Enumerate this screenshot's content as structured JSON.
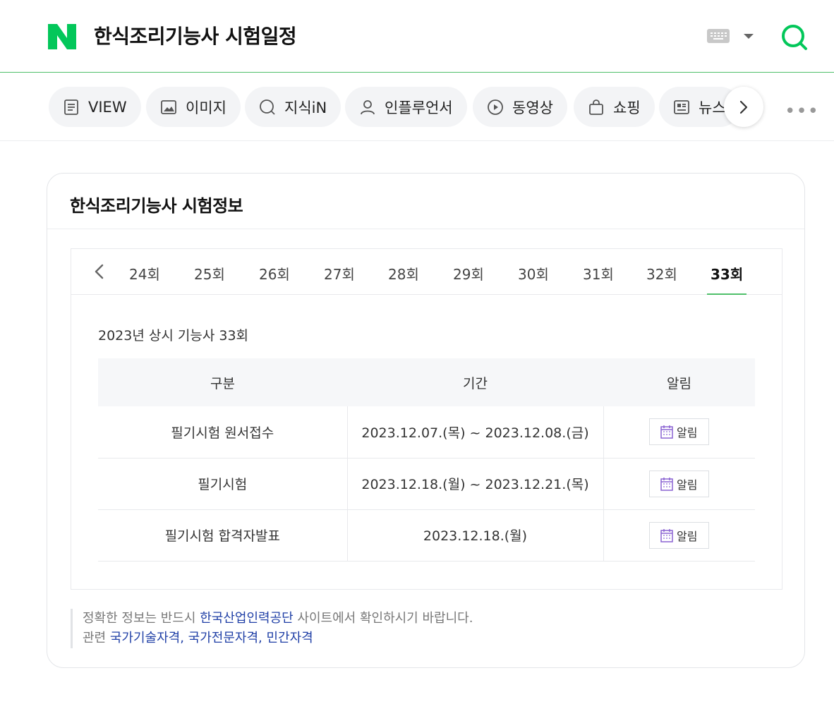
{
  "header": {
    "query": "한식조리기능사 시험일정",
    "brand_color": "#03c75a"
  },
  "tabs": [
    {
      "label": "VIEW",
      "icon": "view-icon"
    },
    {
      "label": "이미지",
      "icon": "image-icon"
    },
    {
      "label": "지식iN",
      "icon": "kin-icon"
    },
    {
      "label": "인플루언서",
      "icon": "person-icon"
    },
    {
      "label": "동영상",
      "icon": "play-icon"
    },
    {
      "label": "쇼핑",
      "icon": "bag-icon"
    },
    {
      "label": "뉴스",
      "icon": "news-icon"
    }
  ],
  "more_label": "•••",
  "card": {
    "title": "한식조리기능사 시험정보",
    "rounds": [
      "24회",
      "25회",
      "26회",
      "27회",
      "28회",
      "29회",
      "30회",
      "31회",
      "32회",
      "33회"
    ],
    "active_round": "33회",
    "exam_title": "2023년 상시 기능사 33회",
    "table": {
      "headers": [
        "구분",
        "기간",
        "알림"
      ],
      "rows": [
        {
          "category": "필기시험 원서접수",
          "period": "2023.12.07.(목) ~ 2023.12.08.(금)",
          "action": "알림"
        },
        {
          "category": "필기시험",
          "period": "2023.12.18.(월) ~ 2023.12.21.(목)",
          "action": "알림"
        },
        {
          "category": "필기시험 합격자발표",
          "period": "2023.12.18.(월)",
          "action": "알림"
        }
      ]
    },
    "notice": {
      "prefix": "정확한 정보는 반드시 ",
      "link": "한국산업인력공단",
      "suffix": " 사이트에서 확인하시기 바랍니다.",
      "related_label": "관련 ",
      "related_links": [
        "국가기술자격",
        "국가전문자격",
        "민간자격"
      ],
      "separator": ", "
    }
  }
}
